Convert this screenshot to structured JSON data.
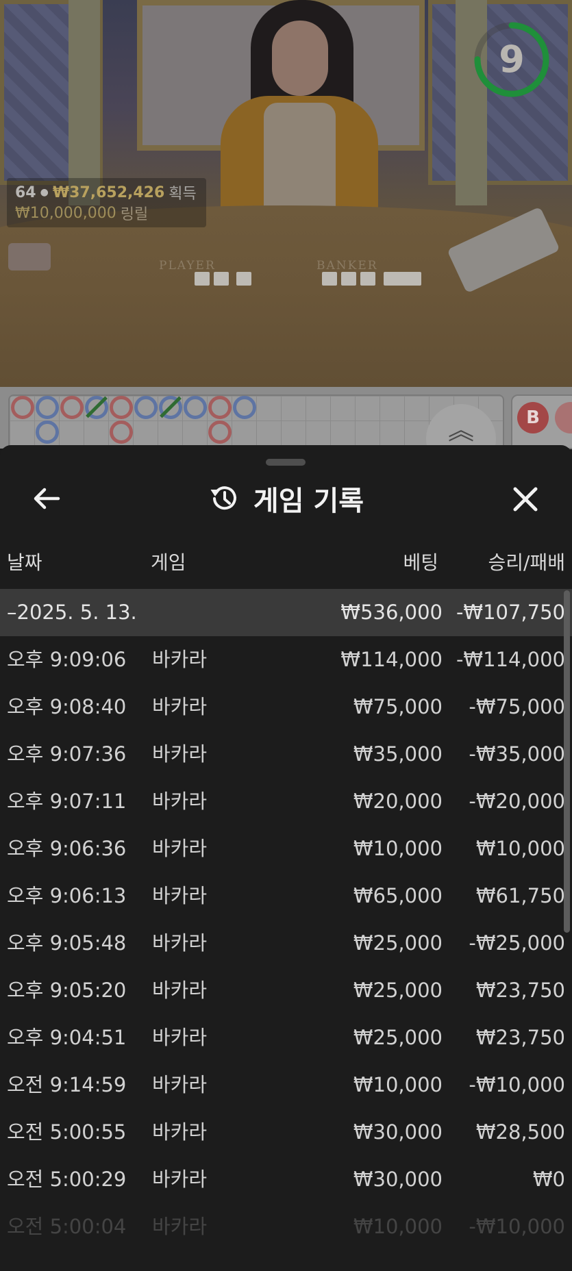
{
  "live": {
    "players": "64",
    "win_amount": "₩37,652,426",
    "win_word": "획득",
    "jackpot_amount": "₩10,000,000",
    "jackpot_word": "링릴",
    "timer": "9",
    "timer_fraction": 0.75,
    "timer_color": "#1f8f3a",
    "player_label": "PLAYER",
    "banker_label": "BANKER"
  },
  "roadmap": {
    "badge": "B",
    "player_color": "#5e74a3",
    "banker_color": "#a45d5d"
  },
  "history": {
    "title": "게임 기록",
    "back_icon": "arrow-left-icon",
    "history_icon": "history-clock-icon",
    "close_icon": "close-icon",
    "columns": {
      "date": "날짜",
      "game": "게임",
      "bet": "베팅",
      "result": "승리/패배"
    },
    "day": {
      "date": "–2025. 5. 13.",
      "bet": "₩536,000",
      "result": "-₩107,750"
    },
    "rows": [
      {
        "time": "오후 9:09:06",
        "game": "바카라",
        "bet": "₩114,000",
        "result": "-₩114,000"
      },
      {
        "time": "오후 9:08:40",
        "game": "바카라",
        "bet": "₩75,000",
        "result": "-₩75,000"
      },
      {
        "time": "오후 9:07:36",
        "game": "바카라",
        "bet": "₩35,000",
        "result": "-₩35,000"
      },
      {
        "time": "오후 9:07:11",
        "game": "바카라",
        "bet": "₩20,000",
        "result": "-₩20,000"
      },
      {
        "time": "오후 9:06:36",
        "game": "바카라",
        "bet": "₩10,000",
        "result": "₩10,000"
      },
      {
        "time": "오후 9:06:13",
        "game": "바카라",
        "bet": "₩65,000",
        "result": "₩61,750"
      },
      {
        "time": "오후 9:05:48",
        "game": "바카라",
        "bet": "₩25,000",
        "result": "-₩25,000"
      },
      {
        "time": "오후 9:05:20",
        "game": "바카라",
        "bet": "₩25,000",
        "result": "₩23,750"
      },
      {
        "time": "오후 9:04:51",
        "game": "바카라",
        "bet": "₩25,000",
        "result": "₩23,750"
      },
      {
        "time": "오전 9:14:59",
        "game": "바카라",
        "bet": "₩10,000",
        "result": "-₩10,000"
      },
      {
        "time": "오전 5:00:55",
        "game": "바카라",
        "bet": "₩30,000",
        "result": "₩28,500"
      },
      {
        "time": "오전 5:00:29",
        "game": "바카라",
        "bet": "₩30,000",
        "result": "₩0"
      },
      {
        "time": "오전 5:00:04",
        "game": "바카라",
        "bet": "₩10,000",
        "result": "-₩10,000"
      }
    ]
  }
}
